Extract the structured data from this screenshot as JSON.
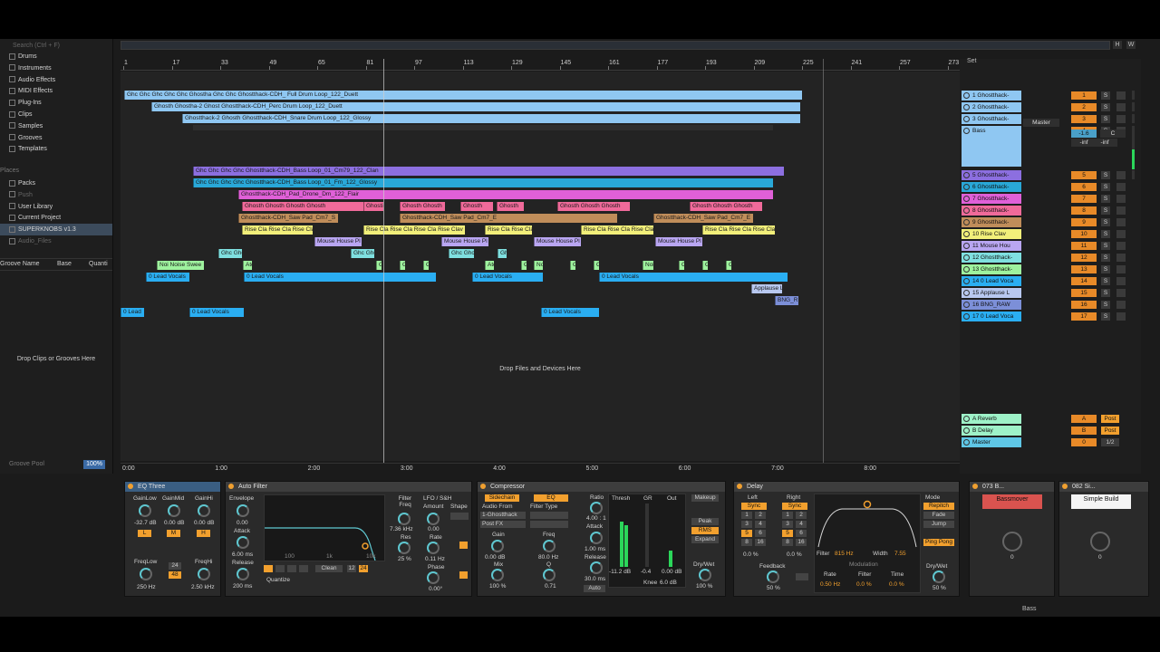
{
  "browser": {
    "search_placeholder": "Search (Ctrl + F)",
    "categories": [
      "Drums",
      "Instruments",
      "Audio Effects",
      "MIDI Effects",
      "Plug-Ins",
      "Clips",
      "Samples",
      "Grooves",
      "Templates"
    ],
    "places_label": "Places",
    "places": [
      "Packs",
      "Push",
      "User Library",
      "Current Project",
      "SUPERKNOBS v1.3",
      "Audio_Files"
    ],
    "groove_cols": [
      "Groove Name",
      "Base",
      "Quanti"
    ],
    "drop_text": "Drop Clips or Grooves Here",
    "groove_pool": "Groove Pool",
    "groove_pool_value": "100%"
  },
  "overview_buttons": [
    "H",
    "W"
  ],
  "ruler_bars": [
    "1",
    "17",
    "33",
    "49",
    "65",
    "81",
    "97",
    "113",
    "129",
    "145",
    "161",
    "177",
    "193",
    "209",
    "225",
    "241",
    "257",
    "273"
  ],
  "time_marks": [
    "0:00",
    "1:00",
    "2:00",
    "3:00",
    "4:00",
    "5:00",
    "6:00",
    "7:00",
    "8:00"
  ],
  "drop_devices": "Drop Files and Devices Here",
  "lanes": [
    {
      "color": "#8fc7f2",
      "clips": [
        {
          "label": "Ghc Ghc Ghc Ghc Ghc Ghostha Ghc Ghc Ghostthack-CDH_ Full Drum Loop_122_Duett"
        }
      ]
    },
    {
      "color": "#8fc7f2",
      "clips": [
        {
          "label": "Ghosth Ghostha-2 Ghost Ghostthack-CDH_Perc Drum Loop_122_Duett"
        }
      ]
    },
    {
      "color": "#8fc7f2",
      "clips": [
        {
          "label": "Ghostthack-2 Ghosth Ghostthack-CDH_Snare Drum Loop_122_Glossy"
        }
      ]
    },
    {
      "color": "#8c6fe0",
      "clips": [
        {
          "label": "Ghc Ghc Ghc Ghc Ghostthack-CDH_Bass Loop_01_Cm79_122_Clan"
        }
      ]
    },
    {
      "color": "#29a8d8",
      "clips": [
        {
          "label": "Ghc Ghc Ghc Ghc Ghostthack-CDH_Bass Loop_01_Fm_122_Glossy"
        }
      ]
    },
    {
      "color": "#e060d8",
      "clips": [
        {
          "label": "Ghostthack-CDH_Pad_Drone_Dm_122_Flair"
        }
      ]
    },
    {
      "color": "#f06a9a",
      "clips": [
        {
          "label": "Ghosth Ghosth Ghosth Ghosth"
        },
        {
          "label": "Ghosti"
        },
        {
          "label": "Ghosth Ghosth"
        },
        {
          "label": "Ghosth"
        },
        {
          "label": "Ghosth"
        },
        {
          "label": "Ghosth Ghosth Ghosth"
        },
        {
          "label": "Ghosth Ghosth Ghosth"
        }
      ]
    },
    {
      "color": "#c08d5a",
      "clips": [
        {
          "label": "Ghostthack-CDH_Saw Pad_Cm7_S"
        },
        {
          "label": "Ghostthack-CDH_Saw Pad_Cm7_E"
        },
        {
          "label": "Ghostthack-CDH_Saw Pad_Cm7_E"
        }
      ]
    },
    {
      "color": "#f2ef7a",
      "clips": [
        {
          "label": "Rise Cla Rise Cla Rise Cla"
        },
        {
          "label": "Rise Cla Rise Cla Rise Cla Rise Clav 3"
        },
        {
          "label": "Rise Cla Rise Cla"
        },
        {
          "label": "Rise Cla Rise Cla Rise Cla"
        },
        {
          "label": "Rise Cla Rise Cla Rise Cla"
        }
      ]
    },
    {
      "color": "#b9a6f2",
      "clips": [
        {
          "label": "Mouse House Pl"
        },
        {
          "label": "Mouse House Pl"
        },
        {
          "label": "Mouse House Pl"
        },
        {
          "label": "Mouse House Pl"
        }
      ]
    },
    {
      "color": "#7fe0e0",
      "clips": [
        {
          "label": "Ghc Ghc"
        },
        {
          "label": "Ghc Ghc"
        },
        {
          "label": "Ghc Ghc"
        },
        {
          "label": "Gh"
        }
      ]
    },
    {
      "color": "#9ef29e",
      "clips": [
        {
          "label": "Noi Noise Swee"
        },
        {
          "label": "Atd"
        },
        {
          "label": "G"
        },
        {
          "label": "G"
        },
        {
          "label": "G"
        },
        {
          "label": "Atd"
        },
        {
          "label": "G"
        },
        {
          "label": "Noi"
        },
        {
          "label": "G"
        },
        {
          "label": "G"
        },
        {
          "label": "Noi"
        },
        {
          "label": "G"
        },
        {
          "label": "G"
        },
        {
          "label": "G"
        }
      ]
    },
    {
      "color": "#2aaef2",
      "clips": [
        {
          "label": "0 Lead Vocals"
        },
        {
          "label": "0 Lead Vocals"
        },
        {
          "label": "0 Lead Vocals"
        },
        {
          "label": "0 Lead Vocals"
        }
      ]
    },
    {
      "color": "#b8c8f0",
      "clips": [
        {
          "label": "Applause L"
        }
      ]
    },
    {
      "color": "#7c8fd8",
      "clips": [
        {
          "label": "BNG_R"
        }
      ]
    },
    {
      "color": "#2aaef2",
      "clips": [
        {
          "label": "0 Lead"
        },
        {
          "label": "0 Lead Vocals"
        },
        {
          "label": "0 Lead Vocals"
        }
      ]
    }
  ],
  "tracks": [
    {
      "name": "1 Ghostthack-",
      "color": "#8fc7f2",
      "num": "1"
    },
    {
      "name": "2 Ghostthack-",
      "color": "#8fc7f2",
      "num": "2"
    },
    {
      "name": "3 Ghostthack-",
      "color": "#8fc7f2",
      "num": "3"
    },
    {
      "name": "Bass",
      "color": "#8fc7f2",
      "num": "4"
    },
    {
      "name": "5 Ghostthack-",
      "color": "#8c6fe0",
      "num": "5"
    },
    {
      "name": "6 Ghostthack-",
      "color": "#29a8d8",
      "num": "6"
    },
    {
      "name": "7 Ghostthack-",
      "color": "#e060d8",
      "num": "7"
    },
    {
      "name": "8 Ghostthack-",
      "color": "#f06a9a",
      "num": "8"
    },
    {
      "name": "9 Ghostthack-",
      "color": "#c08d5a",
      "num": "9"
    },
    {
      "name": "10 Rise Clav",
      "color": "#f2ef7a",
      "num": "10"
    },
    {
      "name": "11 Mouse Hou",
      "color": "#b9a6f2",
      "num": "11"
    },
    {
      "name": "12 Ghostthack-",
      "color": "#7fe0e0",
      "num": "12"
    },
    {
      "name": "13 Ghostthack-",
      "color": "#9ef29e",
      "num": "13"
    },
    {
      "name": "14 0 Lead Voca",
      "color": "#2aaef2",
      "num": "14"
    },
    {
      "name": "15 Applause L",
      "color": "#b8c8f0",
      "num": "15"
    },
    {
      "name": "16 BNG_RAW",
      "color": "#7c8fd8",
      "num": "16"
    },
    {
      "name": "17 0 Lead Voca",
      "color": "#2aaef2",
      "num": "17"
    }
  ],
  "returns": [
    {
      "name": "A Reverb",
      "color": "#9ef2c8",
      "num": "A",
      "send": "Post"
    },
    {
      "name": "B Delay",
      "color": "#9ef2c8",
      "num": "B",
      "send": "Post"
    },
    {
      "name": "Master",
      "color": "#5fc7e6",
      "num": "0",
      "send": "1/2"
    }
  ],
  "bass_track": {
    "routing": "Master",
    "vol": "-1.6",
    "pan": "C",
    "inf1": "-inf",
    "inf2": "-inf"
  },
  "mixer_set_label": "Set",
  "devices": {
    "eq_three": {
      "title": "EQ Three",
      "gain_labels": [
        "GainLow",
        "GainMid",
        "GainHi"
      ],
      "gain_values": [
        "-32.7 dB",
        "0.00 dB",
        "0.00 dB"
      ],
      "bands": [
        "L",
        "M",
        "H"
      ],
      "freq_labels": [
        "FreqLow",
        "FreqHi"
      ],
      "freq_values": [
        "250 Hz",
        "2.50 kHz"
      ],
      "slope": [
        "24",
        "48"
      ]
    },
    "auto_filter": {
      "title": "Auto Filter",
      "envelope": "Envelope",
      "env_val": "0.00",
      "attack": "Attack",
      "attack_val": "6.00 ms",
      "release": "Release",
      "release_val": "200 ms",
      "freq_label": "Filter Freq",
      "freq_val": "7.36 kHz",
      "res_label": "Res",
      "res_val": "25 %",
      "lfo_label": "LFO / S&H",
      "amount": "Amount",
      "amount_val": "0.00",
      "shape": "Shape",
      "rate": "Rate",
      "rate_val": "0.11 Hz",
      "phase": "Phase",
      "phase_val": "0.00°",
      "quantize": "Quantize",
      "clean": "Clean",
      "q12": "12",
      "q24": "24",
      "graph_ticks": [
        "100",
        "1k",
        "10k"
      ]
    },
    "compressor": {
      "title": "Compressor",
      "sidechain": "Sidechain",
      "eq": "EQ",
      "audio_from": "Audio From",
      "source": "1-Ghostthack",
      "post": "Post FX",
      "filter_type": "Filter Type",
      "gain": "Gain",
      "gain_val": "0.00 dB",
      "mix": "Mix",
      "mix_val": "100 %",
      "freq": "Freq",
      "freq_val": "80.0 Hz",
      "q": "Q",
      "q_val": "0.71",
      "ratio": "Ratio",
      "ratio_val": "4.00 : 1",
      "attack": "Attack",
      "attack_val": "1.00 ms",
      "release": "Release",
      "release_val": "30.0 ms",
      "auto": "Auto",
      "thresh": "Thresh",
      "gr": "GR",
      "out": "Out",
      "thresh_val": "-11.2 dB",
      "gr_val": "-0.4",
      "out_val": "0.00 dB",
      "knee": "Knee",
      "knee_val": "6.0 dB",
      "makeup": "Makeup",
      "peak": "Peak",
      "rms": "RMS",
      "expand": "Expand",
      "drywet": "Dry/Wet",
      "drywet_val": "100 %"
    },
    "delay": {
      "title": "Delay",
      "left": "Left",
      "right": "Right",
      "sync": "Sync",
      "steps": [
        "1",
        "2",
        "3",
        "4",
        "5",
        "6",
        "8",
        "16"
      ],
      "left_val": "0.0 %",
      "right_val": "0.0 %",
      "feedback": "Feedback",
      "feedback_val": "50 %",
      "filter": "Filter",
      "filter_val": "815 Hz",
      "width": "Width",
      "width_val": "7.55",
      "modulation": "Modulation",
      "rate": "Rate",
      "rate_val": "0.50 Hz",
      "filt": "Filter",
      "filt_val": "0.0 %",
      "time": "Time",
      "time_val": "0.0 %",
      "mode": "Mode",
      "modes": [
        "Repitch",
        "Fade",
        "Jump"
      ],
      "pingpong": "Ping Pong",
      "drywet": "Dry/Wet",
      "drywet_val": "50 %"
    },
    "rack1": {
      "title": "073 B...",
      "macro": "Bassmover",
      "val": "0"
    },
    "rack2": {
      "title": "082 Si...",
      "macro": "Simple Build",
      "val": "0"
    }
  },
  "status_right": "Bass"
}
